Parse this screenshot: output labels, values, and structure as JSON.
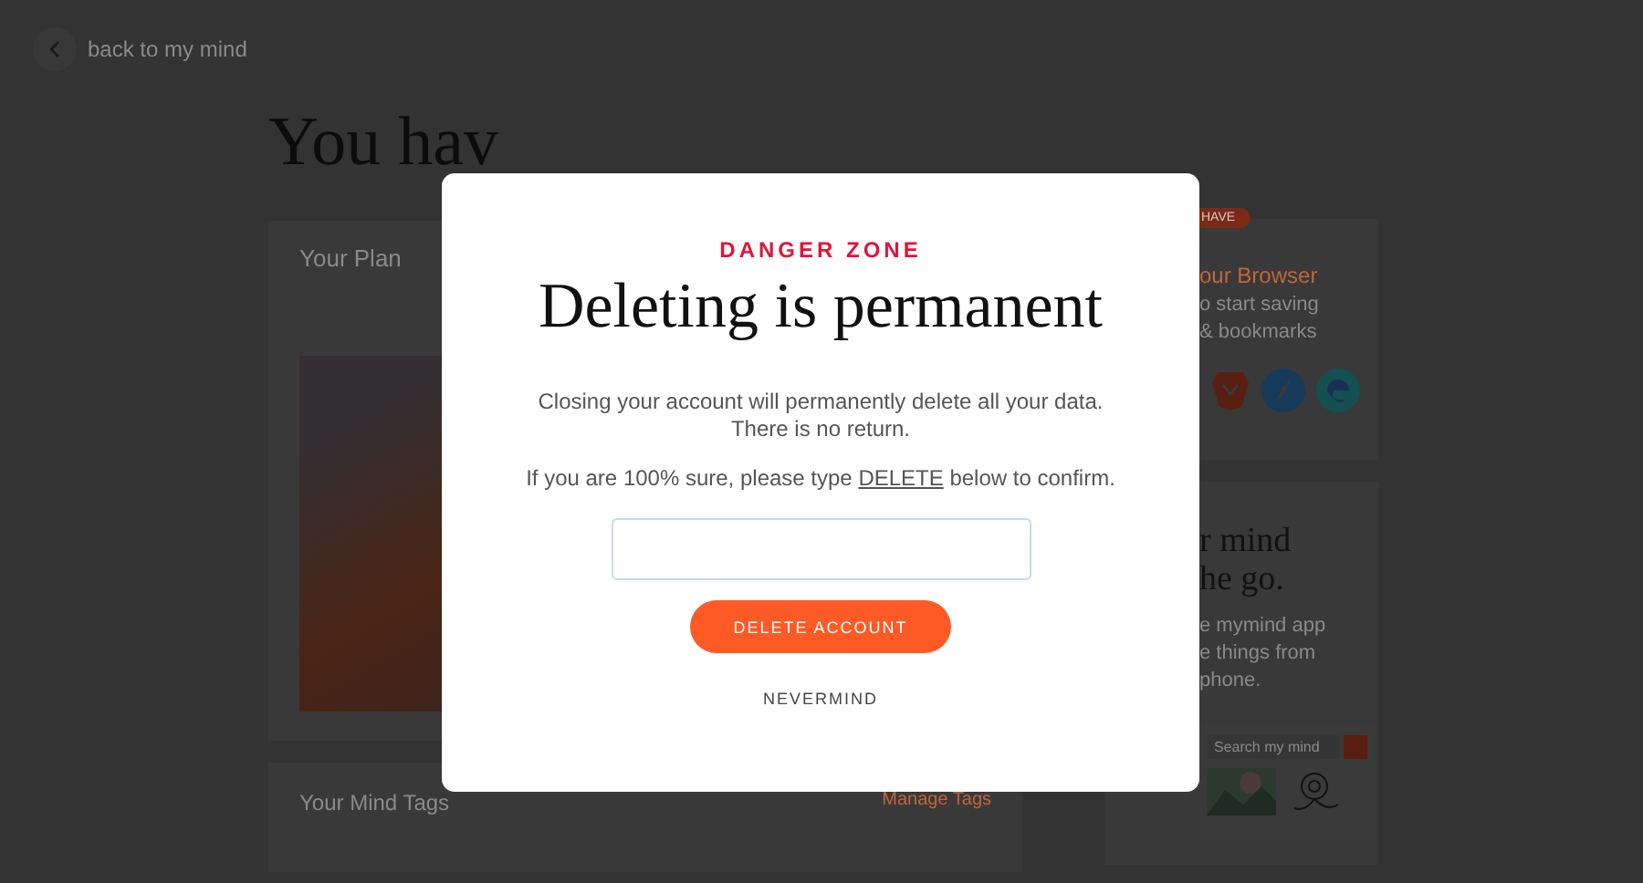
{
  "back_link": {
    "label": "back to my mind"
  },
  "heading": "You hav",
  "plan_card": {
    "title": "Your Plan"
  },
  "tags_card": {
    "title": "Your Mind Tags",
    "action": "Manage Tags"
  },
  "browser_card": {
    "badge": "HAVE",
    "title": "our Browser",
    "text_lines": [
      "o start saving",
      "& bookmarks"
    ]
  },
  "app_card": {
    "title_lines": [
      "r mind",
      "he go."
    ],
    "text_lines": [
      "e mymind app",
      "e things from",
      "phone."
    ],
    "search_placeholder": "Search my mind"
  },
  "modal": {
    "eyebrow": "DANGER ZONE",
    "title": "Deleting is permanent",
    "message_lines": [
      "Closing your account will permanently delete all your data.",
      "There is no return."
    ],
    "instruction_before": "If you are 100% sure, please type ",
    "keyword": "DELETE",
    "instruction_after": " below to confirm.",
    "confirm_button": "DELETE ACCOUNT",
    "cancel_button": "NEVERMIND"
  }
}
